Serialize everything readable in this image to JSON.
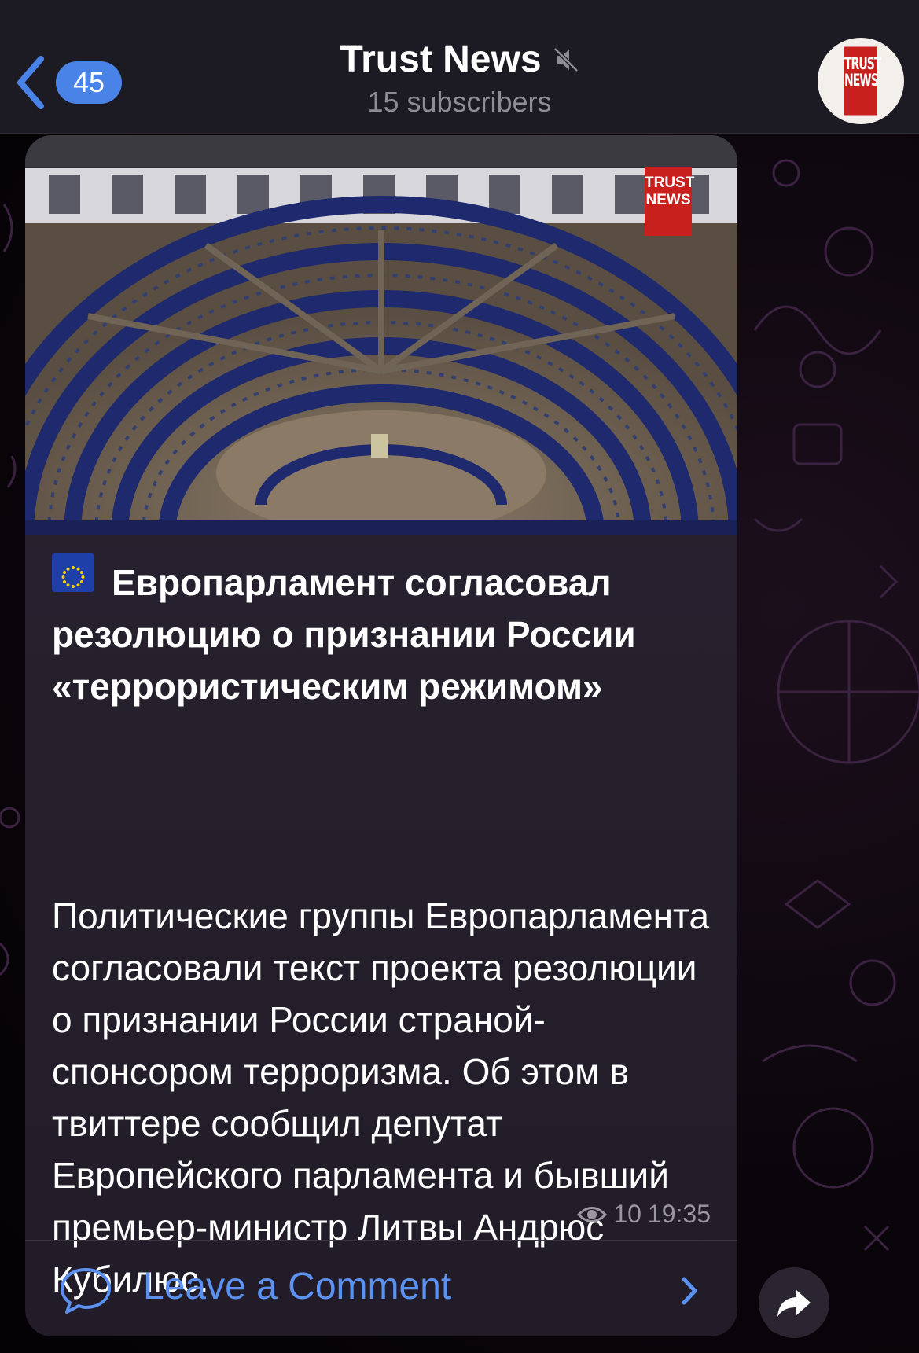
{
  "header": {
    "back_count": "45",
    "channel_title": "Trust News",
    "subscribers": "15 subscribers",
    "avatar_text": "TRUST NEWS"
  },
  "post": {
    "photo_logo_text": "TRUST NEWS",
    "flag": "🇪🇺",
    "title": "Европарламент согласовал резолюцию о признании России «террористическим режимом»",
    "body": "Политические группы Европарламента согласовали текст проекта резолюции о признании России страной-спонсором терроризма. Об этом в твиттере сообщил депутат Европейского парламента и бывший премьер-министр Литвы Андрюс Кубилюс.",
    "views": "10",
    "time": "19:35"
  },
  "comments": {
    "label": "Leave a Comment"
  },
  "icons": {
    "back": "chevron-left-icon",
    "mute": "muted-speaker-icon",
    "views": "eye-icon",
    "comment": "speech-bubble-icon",
    "share": "share-arrow-icon"
  },
  "colors": {
    "accent": "#4a83e8",
    "link": "#5b91f0",
    "brand_red": "#c8201d",
    "header_bg": "#1c1a22",
    "bubble_bg": "#2a2331"
  }
}
